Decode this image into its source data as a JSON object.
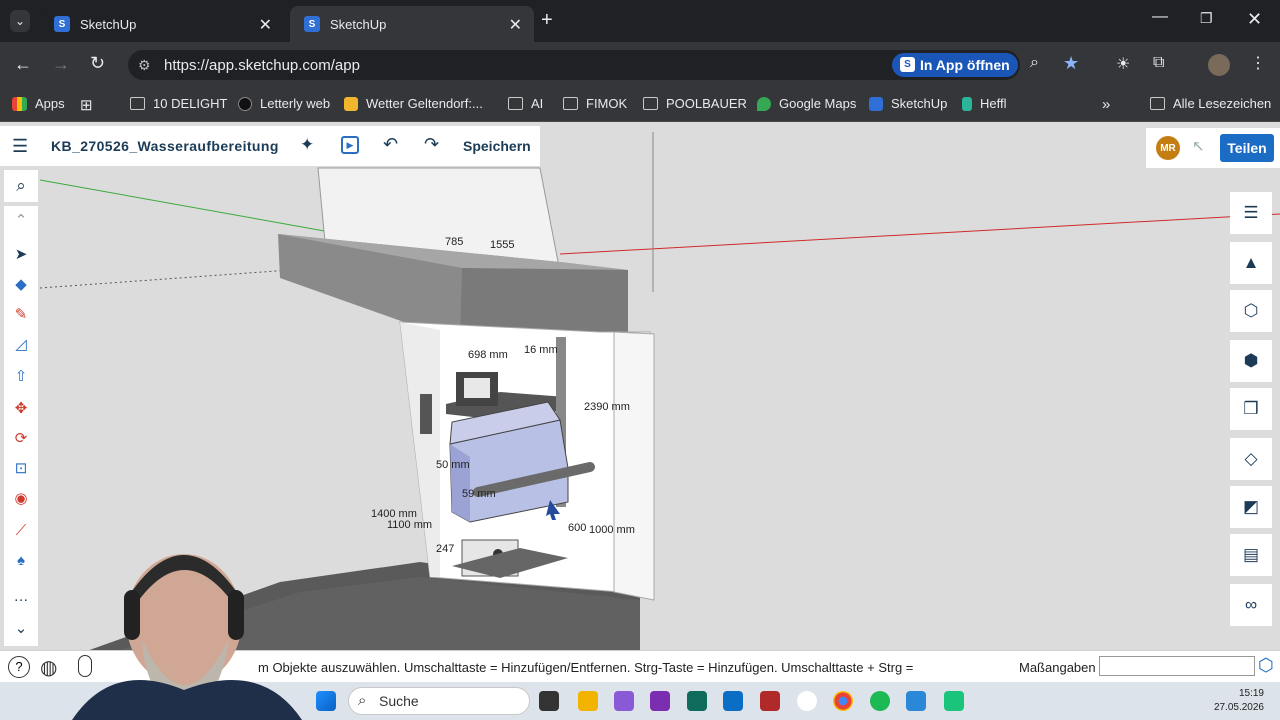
{
  "browser": {
    "tabs": [
      {
        "title": "SketchUp",
        "active": false
      },
      {
        "title": "SketchUp",
        "active": true
      }
    ],
    "url": "https://app.sketchup.com/app",
    "open_in_app_label": "In App öffnen",
    "bookmarks": [
      "Apps",
      "10 DELIGHT",
      "Letterly web",
      "Wetter Geltendorf:...",
      "AI",
      "FIMOK",
      "POOLBAUER",
      "Google Maps",
      "SketchUp",
      "Heffl"
    ],
    "all_bookmarks_label": "Alle Lesezeichen"
  },
  "app": {
    "filename": "KB_270526_Wasseraufbereitung",
    "save_label": "Speichern",
    "avatar_initials": "MR",
    "share_label": "Teilen",
    "status_text": "m Objekte auszuwählen. Umschalttaste = Hinzufügen/Entfernen. Strg-Taste = Hinzufügen. Umschalttaste + Strg =",
    "measurements_label": "Maßangaben",
    "measurements_value": ""
  },
  "model_labels": {
    "d1555": "1555",
    "d785": "785",
    "d698": "698 mm",
    "d16": "16 mm",
    "d2390": "2390 mm",
    "d1400": "1400 mm",
    "d1100": "1100 mm",
    "d600": "600",
    "d1000": "1000 mm",
    "d50": "50 mm",
    "d59": "59 mm",
    "d247": "247"
  },
  "taskbar": {
    "search_placeholder": "Suche",
    "time": "15:19",
    "date": "27.05.2026"
  },
  "colors": {
    "accent": "#1a6cc4",
    "avatar": "#c47d12",
    "appbg": "#dcdcdc"
  }
}
